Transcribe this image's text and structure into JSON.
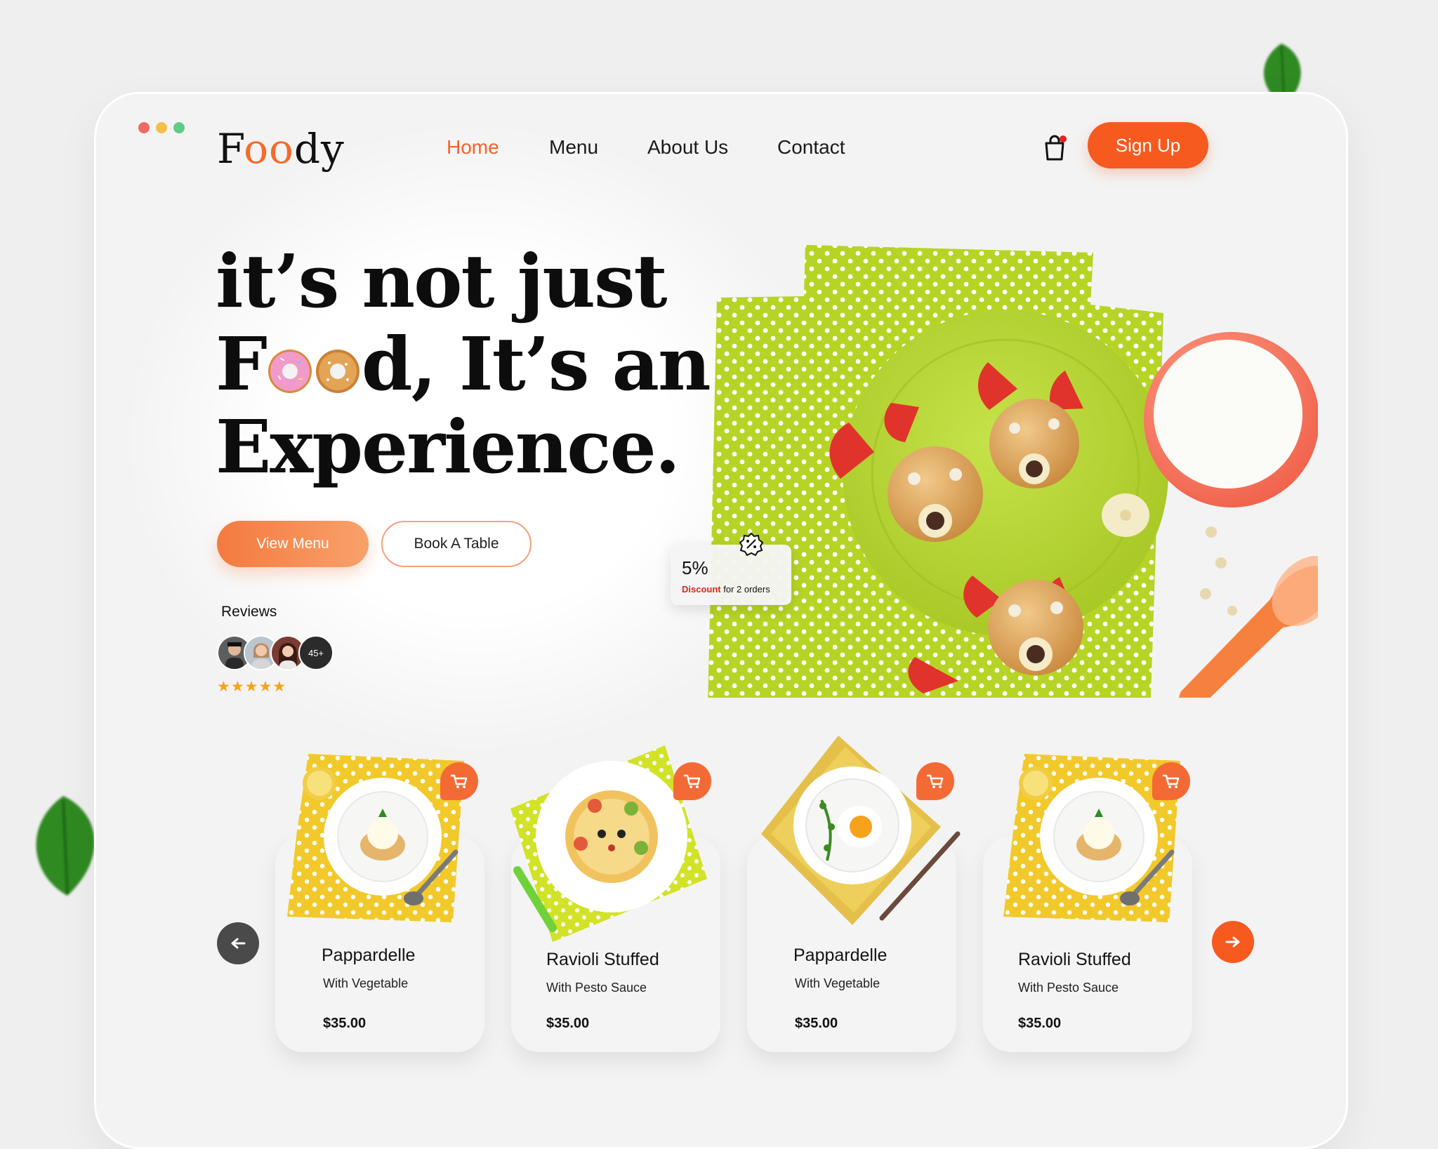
{
  "window": {
    "controls": [
      "close",
      "minimize",
      "maximize"
    ],
    "control_colors": [
      "#ee6a63",
      "#f4c046",
      "#5fcc86"
    ]
  },
  "brand": {
    "logo_f": "F",
    "logo_oo": "oo",
    "logo_dy": "dy"
  },
  "nav": {
    "items": [
      {
        "label": "Home",
        "active": true
      },
      {
        "label": "Menu",
        "active": false
      },
      {
        "label": "About Us",
        "active": false
      },
      {
        "label": "Contact",
        "active": false
      }
    ],
    "cart_icon": "shopping-bag-icon",
    "signup_label": "Sign Up"
  },
  "hero": {
    "line1": "it’s not just",
    "line2_f": "F",
    "line2_rest": "d, It’s an",
    "line3": "Experience.",
    "view_menu_label": "View Menu",
    "book_table_label": "Book A Table",
    "reviews_label": "Reviews",
    "reviews_count": "45+",
    "rating_stars": "★★★★★",
    "rating": 5
  },
  "discount": {
    "percent": "5%",
    "label": "Discount",
    "suffix": "for 2 orders"
  },
  "products": [
    {
      "title": "Pappardelle",
      "subtitle": "With Vegetable",
      "price": "$35.00"
    },
    {
      "title": "Ravioli Stuffed",
      "subtitle": "With Pesto Sauce",
      "price": "$35.00"
    },
    {
      "title": "Pappardelle",
      "subtitle": "With Vegetable",
      "price": "$35.00"
    },
    {
      "title": "Ravioli Stuffed",
      "subtitle": "With Pesto Sauce",
      "price": "$35.00"
    }
  ],
  "colors": {
    "accent": "#f65a1f",
    "accent_light": "#f8a16b",
    "star": "#f6a21c",
    "napkin_green": "#b6d425",
    "napkin_yellow": "#f2c92a"
  }
}
